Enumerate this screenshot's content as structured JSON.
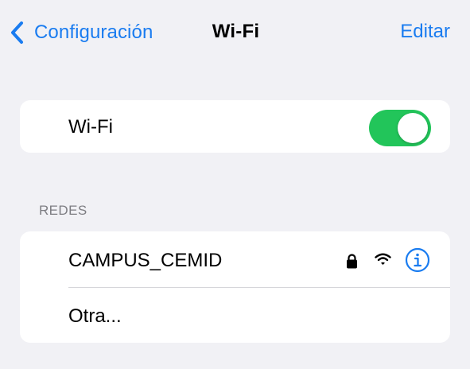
{
  "navbar": {
    "back_label": "Configuración",
    "title": "Wi-Fi",
    "edit_label": "Editar"
  },
  "wifi_toggle": {
    "label": "Wi-Fi",
    "enabled": true
  },
  "networks": {
    "section_header": "REDES",
    "items": [
      {
        "ssid": "CAMPUS_CEMID",
        "secured": true,
        "icons": [
          "lock-icon",
          "wifi-signal-icon",
          "info-icon"
        ]
      }
    ],
    "other_label": "Otra..."
  },
  "colors": {
    "accent": "#1a7cf0",
    "toggle_on": "#22c55a",
    "background": "#f1f1f5",
    "section_header": "#7d7d82"
  }
}
